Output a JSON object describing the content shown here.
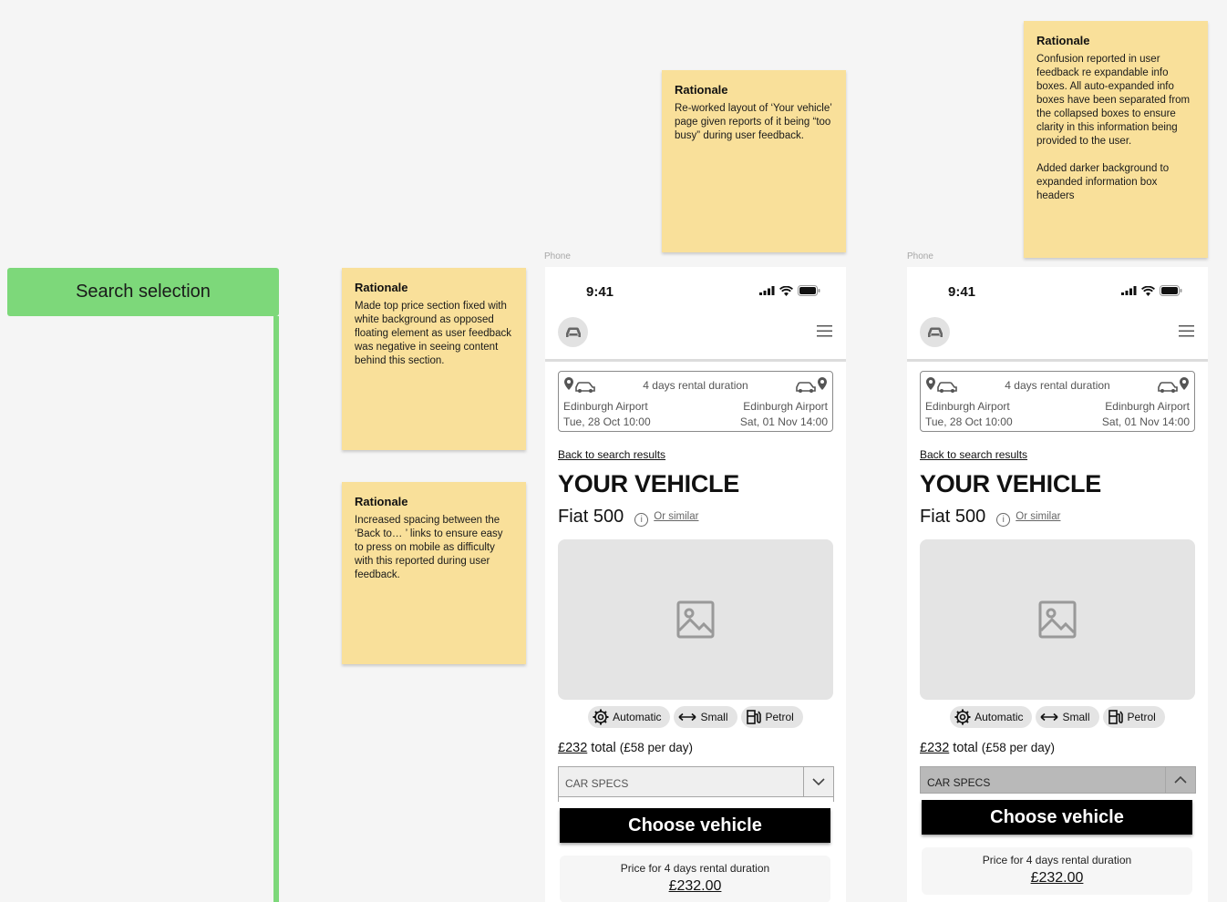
{
  "section": {
    "label": "Search selection"
  },
  "notes": [
    {
      "title": "Rationale",
      "text": "Made top price section fixed with white background as opposed floating element as user feedback was negative in seeing content behind this section."
    },
    {
      "title": "Rationale",
      "text": "Increased spacing between the ‘Back to… ’ links to ensure easy to press on mobile as difficulty with this reported during user feedback."
    },
    {
      "title": "Rationale",
      "text": "Re-worked layout of ‘Your vehicle’ page given reports of it being “too busy” during user feedback."
    },
    {
      "title": "Rationale",
      "text": "Confusion reported in user feedback re expandable info boxes.  All auto-expanded info boxes have been separated from the collapsed boxes to ensure clarity in this information being provided to the user.\n\nAdded darker background to expanded information box headers"
    }
  ],
  "phones": [
    {
      "frame_label": "Phone",
      "status_time": "9:41",
      "trip": {
        "duration": "4 days rental duration",
        "pickup_location": "Edinburgh Airport",
        "pickup_date": "Tue, 28 Oct 10:00",
        "dropoff_location": "Edinburgh Airport",
        "dropoff_date": "Sat, 01 Nov 14:00"
      },
      "back_link": "Back to search results",
      "title": "YOUR VEHICLE",
      "model": "Fiat 500",
      "similar": "Or similar",
      "features": [
        "Automatic",
        "Small",
        "Petrol"
      ],
      "price_total": "£232",
      "price_total_word": "total",
      "price_per_day": "(£58 per day)",
      "specs_label": "CAR SPECS",
      "cta": "Choose vehicle",
      "price_card_title": "Price for 4 days rental duration",
      "price_card_value": "£232.00"
    },
    {
      "frame_label": "Phone",
      "status_time": "9:41",
      "trip": {
        "duration": "4 days rental duration",
        "pickup_location": "Edinburgh Airport",
        "pickup_date": "Tue, 28 Oct 10:00",
        "dropoff_location": "Edinburgh Airport",
        "dropoff_date": "Sat, 01 Nov 14:00"
      },
      "back_link": "Back to search results",
      "title": "YOUR VEHICLE",
      "model": "Fiat 500",
      "similar": "Or similar",
      "features": [
        "Automatic",
        "Small",
        "Petrol"
      ],
      "price_total": "£232",
      "price_total_word": "total",
      "price_per_day": "(£58 per day)",
      "specs_label": "CAR SPECS",
      "cta": "Choose vehicle",
      "price_card_title": "Price for 4 days rental duration",
      "price_card_value": "£232.00"
    }
  ],
  "colors": {
    "section_green": "#7dd87a",
    "sticky_yellow": "#f9e09a",
    "cta_black": "#000000"
  }
}
